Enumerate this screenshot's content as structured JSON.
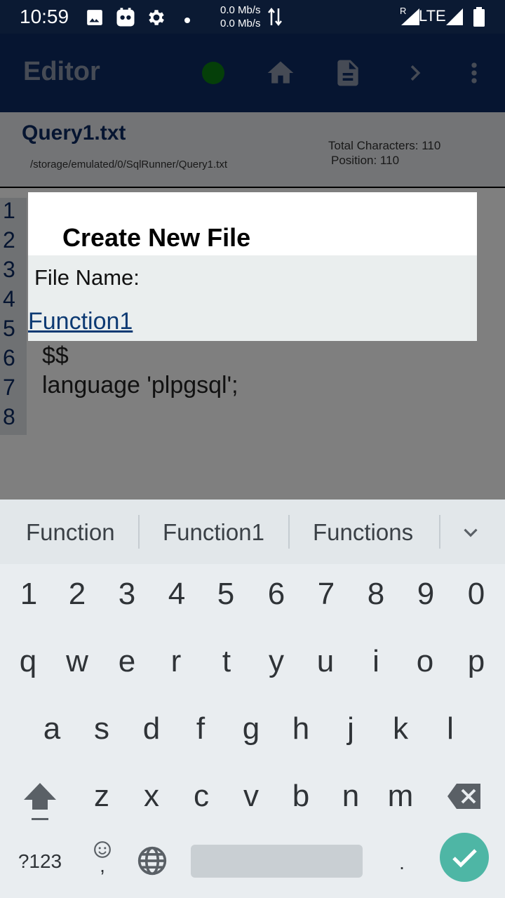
{
  "status_bar": {
    "time": "10:59",
    "net_up": "0.0 Mb/s",
    "net_down": "0.0 Mb/s",
    "roaming": "R",
    "network": "LTE"
  },
  "app_bar": {
    "title": "Editor",
    "status_color": "#0a7f13"
  },
  "file_header": {
    "file_name": "Query1.txt",
    "file_path": "/storage/emulated/0/SqlRunner/Query1.txt",
    "total_characters": "Total Characters: 110",
    "position": "Position: 110"
  },
  "editor": {
    "line_numbers": [
      "1",
      "2",
      "3",
      "4",
      "5",
      "6",
      "7",
      "8"
    ],
    "lines": [
      "$$",
      "language 'plpgsql';"
    ]
  },
  "dialog": {
    "title": "Create New File",
    "field_label": "File Name:",
    "field_value": "Function1"
  },
  "keyboard": {
    "suggestions": [
      "Function",
      "Function1",
      "Functions"
    ],
    "row_numbers": [
      "1",
      "2",
      "3",
      "4",
      "5",
      "6",
      "7",
      "8",
      "9",
      "0"
    ],
    "row_1": [
      "q",
      "w",
      "e",
      "r",
      "t",
      "y",
      "u",
      "i",
      "o",
      "p"
    ],
    "row_2": [
      "a",
      "s",
      "d",
      "f",
      "g",
      "h",
      "j",
      "k",
      "l"
    ],
    "row_3": [
      "z",
      "x",
      "c",
      "v",
      "b",
      "n",
      "m"
    ],
    "symbols_label": "?123",
    "comma_label": ",",
    "period_label": "."
  },
  "colors": {
    "app_bar": "#0d2b63",
    "status_bar": "#0b1a33",
    "enter_key": "#4eb6a5"
  }
}
